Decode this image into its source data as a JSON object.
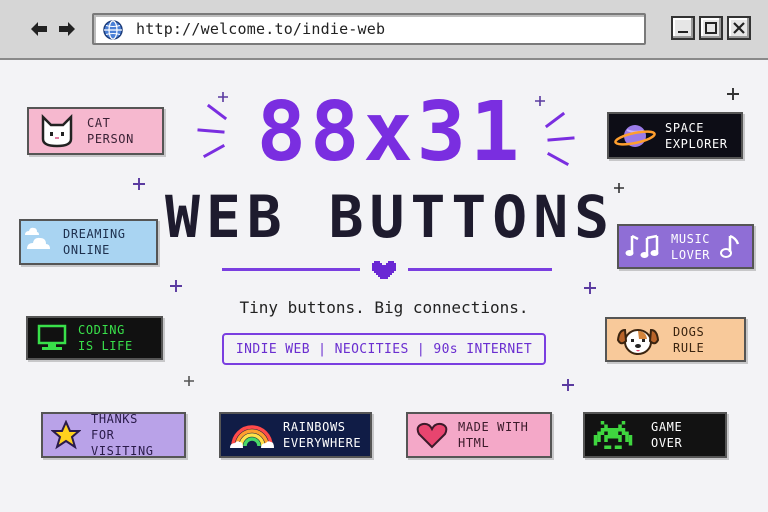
{
  "browser": {
    "url": "http://welcome.to/indie-web"
  },
  "hero": {
    "title_top": "88x31",
    "title_bottom": "WEB BUTTONS",
    "tagline": "Tiny buttons. Big connections.",
    "tags": "INDIE WEB | NEOCITIES | 90s INTERNET"
  },
  "badges": {
    "cat": {
      "label": "CAT\nPERSON",
      "icon": "cat-icon",
      "bg": "#f6b8cf",
      "fg": "#3b2236"
    },
    "dreaming": {
      "label": "DREAMING\nONLINE",
      "icon": "cloud-icon",
      "bg": "#a9d4f2",
      "fg": "#1d2f4d"
    },
    "coding": {
      "label": "CODING\nIS LIFE",
      "icon": "computer-icon",
      "bg": "#111111",
      "fg": "#39e04a"
    },
    "thanks": {
      "label": "THANKS\nFOR VISITING",
      "icon": "star-icon",
      "bg": "#b9a2e8",
      "fg": "#2a1b4a"
    },
    "rainbows": {
      "label": "RAINBOWS\nEVERYWHERE",
      "icon": "rainbow-icon",
      "bg": "#101c46",
      "fg": "#ffffff"
    },
    "made_html": {
      "label": "MADE WITH\nHTML",
      "icon": "heart-icon",
      "bg": "#f4a8c8",
      "fg": "#3b1a2a"
    },
    "game_over": {
      "label": "GAME\nOVER",
      "icon": "space-invader-icon",
      "bg": "#121212",
      "fg": "#ffffff"
    },
    "space": {
      "label": "SPACE\nEXPLORER",
      "icon": "planet-icon",
      "bg": "#0d0d16",
      "fg": "#ffffff"
    },
    "music": {
      "label": "MUSIC\nLOVER",
      "icon": "music-note-icon",
      "bg": "#8f6ed6",
      "fg": "#ffffff"
    },
    "dogs": {
      "label": "DOGS\nRULE",
      "icon": "dog-icon",
      "bg": "#f8c99a",
      "fg": "#3a2410"
    }
  },
  "colors": {
    "accent": "#7a2ee0",
    "title_dark": "#1e1b2e",
    "page_bg": "#f3f3f6",
    "chrome_bg": "#d6d6d6"
  }
}
